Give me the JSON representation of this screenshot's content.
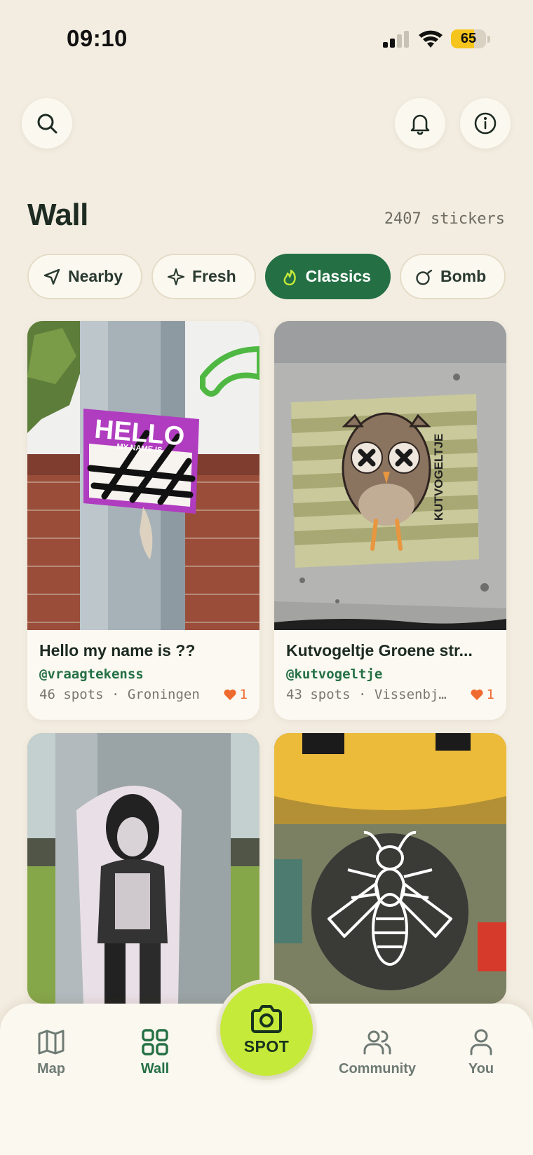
{
  "status": {
    "time": "09:10",
    "battery": "65",
    "battery_level": 0.65
  },
  "header": {
    "title": "Wall",
    "count": "2407 stickers"
  },
  "filters": [
    {
      "label": "Nearby",
      "icon": "navigation-arrow-icon",
      "active": false
    },
    {
      "label": "Fresh",
      "icon": "sparkle-icon",
      "active": false
    },
    {
      "label": "Classics",
      "icon": "flame-icon",
      "active": true
    },
    {
      "label": "Bomb",
      "icon": "bomb-icon",
      "active": false
    }
  ],
  "cards": [
    {
      "title": "Hello my name is ??",
      "user": "@vraagtekenss",
      "meta": "46 spots · Groningen",
      "likes": "1"
    },
    {
      "title": "Kutvogeltje Groene str...",
      "user": "@kutvogeltje",
      "meta": "43 spots · Vissenbj…",
      "likes": "1"
    },
    {
      "title": "",
      "user": "",
      "meta": "",
      "likes": ""
    },
    {
      "title": "",
      "user": "",
      "meta": "",
      "likes": ""
    }
  ],
  "sticker_texts": {
    "hello": "HELLO",
    "my_name": "MY NAME IS",
    "owl": "KUTVOGELTJE"
  },
  "nav": {
    "map": "Map",
    "wall": "Wall",
    "spot": "SPOT",
    "community": "Community",
    "you": "You"
  },
  "colors": {
    "accent": "#247044",
    "spot": "#c6ea3a",
    "like": "#ef6a2f",
    "background": "#f3ede1"
  }
}
